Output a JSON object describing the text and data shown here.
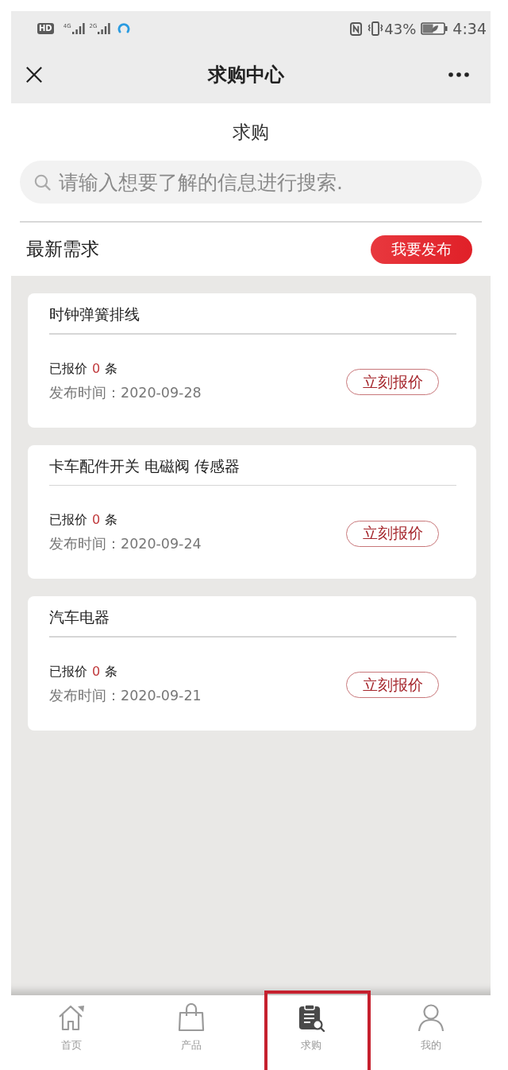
{
  "status_bar": {
    "hd_badge": "HD",
    "signals": [
      {
        "label": "4G"
      },
      {
        "label": "2G"
      }
    ],
    "battery_percent": "43%",
    "time": "4:34"
  },
  "nav_bar": {
    "title": "求购中心"
  },
  "page": {
    "title": "求购",
    "search": {
      "placeholder": "请输入想要了解的信息进行搜索."
    },
    "section": {
      "title": "最新需求",
      "action": "我要发布"
    }
  },
  "requests": [
    {
      "title": "时钟弹簧排线",
      "quote_prefix": "已报价",
      "quote_count": "0",
      "quote_suffix": "条",
      "published": "发布时间：2020-09-28",
      "action": "立刻报价"
    },
    {
      "title": "卡车配件开关 电磁阀 传感器",
      "quote_prefix": "已报价",
      "quote_count": "0",
      "quote_suffix": "条",
      "published": "发布时间：2020-09-24",
      "action": "立刻报价"
    },
    {
      "title": "汽车电器",
      "quote_prefix": "已报价",
      "quote_count": "0",
      "quote_suffix": "条",
      "published": "发布时间：2020-09-21",
      "action": "立刻报价"
    }
  ],
  "tab_bar": [
    {
      "kind": "home",
      "label": "首页",
      "selected": false,
      "highlighted": false
    },
    {
      "kind": "products",
      "label": "产品",
      "selected": false,
      "highlighted": false
    },
    {
      "kind": "requests",
      "label": "求购",
      "selected": true,
      "highlighted": true
    },
    {
      "kind": "profile",
      "label": "我的",
      "selected": false,
      "highlighted": false
    }
  ]
}
